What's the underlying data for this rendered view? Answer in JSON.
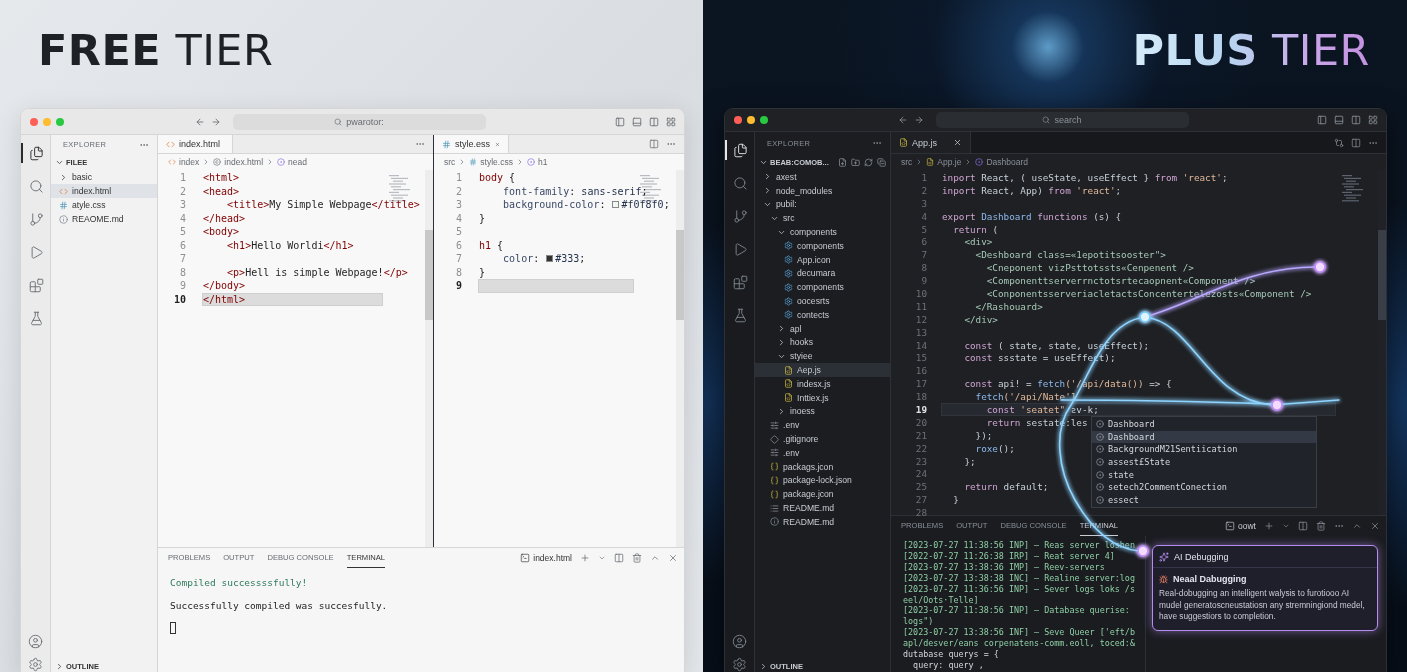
{
  "sides": [
    {
      "kind": "light",
      "heading": {
        "strong": "FREE",
        "light": "TIER"
      },
      "window": {
        "command_center": "pwarotor:",
        "activity": [
          {
            "kind": "files",
            "selected": true
          },
          {
            "kind": "search",
            "selected": false
          },
          {
            "kind": "git",
            "selected": false
          },
          {
            "kind": "run",
            "selected": false
          },
          {
            "kind": "extensions",
            "selected": false
          },
          {
            "kind": "testing",
            "selected": false
          }
        ],
        "sidebar": {
          "title": "EXPLORER",
          "section": "FILEE",
          "section_actions": false,
          "outline": "OUTLINE",
          "items": [
            {
              "label": "basic",
              "kind": "folder",
              "expanded": false,
              "selected": false
            },
            {
              "label": "index.html",
              "kind": "html",
              "selected": true
            },
            {
              "label": "atyle.css",
              "kind": "css",
              "selected": false
            },
            {
              "label": "REAOME.md",
              "kind": "info",
              "selected": false
            }
          ]
        },
        "groups": [
          {
            "tab": {
              "label": "index.html",
              "kind": "html"
            },
            "tab_actions": [
              {
                "kind": "more"
              }
            ],
            "breadcrumbs": [
              {
                "text": "index",
                "kind": "html"
              },
              {
                "text": "index.html",
                "kind": "file"
              },
              {
                "text": "nead",
                "kind": "symbol"
              }
            ],
            "lines": [
              {
                "n": "1",
                "current": false,
                "tokens": [
                  {
                    "kind": "tag",
                    "text": "<html>"
                  }
                ]
              },
              {
                "n": "2",
                "current": false,
                "tokens": [
                  {
                    "kind": "tag",
                    "text": "<head>"
                  }
                ]
              },
              {
                "n": "3",
                "current": false,
                "tokens": [
                  {
                    "kind": "tag",
                    "text": "    <title>"
                  },
                  {
                    "kind": "text",
                    "text": "My Simple Webpage"
                  },
                  {
                    "kind": "tag",
                    "text": "</title>"
                  }
                ]
              },
              {
                "n": "4",
                "current": false,
                "tokens": [
                  {
                    "kind": "tag",
                    "text": "</head>"
                  }
                ]
              },
              {
                "n": "5",
                "current": false,
                "tokens": [
                  {
                    "kind": "tag",
                    "text": "<body>"
                  }
                ]
              },
              {
                "n": "6",
                "current": false,
                "tokens": [
                  {
                    "kind": "tag",
                    "text": "    <h1>"
                  },
                  {
                    "kind": "text",
                    "text": "Hello Worldi"
                  },
                  {
                    "kind": "tag",
                    "text": "</h1>"
                  }
                ]
              },
              {
                "n": "7",
                "current": false
              },
              {
                "n": "8",
                "current": false,
                "tokens": [
                  {
                    "kind": "tag",
                    "text": "    <p>"
                  },
                  {
                    "kind": "text",
                    "text": "Hell is simple Webpage!"
                  },
                  {
                    "kind": "tag",
                    "text": "</p>"
                  }
                ]
              },
              {
                "n": "9",
                "current": false,
                "tokens": [
                  {
                    "kind": "tag",
                    "text": "</body>"
                  }
                ]
              },
              {
                "n": "10",
                "current": true,
                "tokens": [
                  {
                    "kind": "tag",
                    "text": "</html>"
                  }
                ]
              }
            ]
          },
          {
            "tab": {
              "label": "style.ess",
              "kind": "css"
            },
            "tab_actions": [
              {
                "kind": "split"
              },
              {
                "kind": "more"
              }
            ],
            "breadcrumbs": [
              {
                "text": "src",
                "kind": "plain"
              },
              {
                "text": "style.css",
                "kind": "css"
              },
              {
                "text": "h1",
                "kind": "symbol"
              }
            ],
            "lines": [
              {
                "n": "1",
                "current": false,
                "tokens": [
                  {
                    "kind": "sel",
                    "text": "body"
                  },
                  {
                    "kind": "p",
                    "text": " {"
                  }
                ]
              },
              {
                "n": "2",
                "current": false,
                "tokens": [
                  {
                    "kind": "prop",
                    "text": "    font-family"
                  },
                  {
                    "kind": "p",
                    "text": ": "
                  },
                  {
                    "kind": "val",
                    "text": "sans-serif"
                  },
                  {
                    "kind": "p",
                    "text": ";"
                  }
                ]
              },
              {
                "n": "3",
                "current": false,
                "tokens": [
                  {
                    "kind": "prop",
                    "text": "    background-color"
                  },
                  {
                    "kind": "p",
                    "text": ": "
                  },
                  {
                    "kind": "swatch",
                    "color": "#f0f8f0"
                  },
                  {
                    "kind": "val",
                    "text": "#f0f8f0"
                  },
                  {
                    "kind": "p",
                    "text": ";"
                  }
                ]
              },
              {
                "n": "4",
                "current": false,
                "tokens": [
                  {
                    "kind": "p",
                    "text": "}"
                  }
                ]
              },
              {
                "n": "5",
                "current": false
              },
              {
                "n": "6",
                "current": false,
                "tokens": [
                  {
                    "kind": "sel",
                    "text": "h1"
                  },
                  {
                    "kind": "p",
                    "text": " {"
                  }
                ]
              },
              {
                "n": "7",
                "current": false,
                "tokens": [
                  {
                    "kind": "prop",
                    "text": "    color"
                  },
                  {
                    "kind": "p",
                    "text": ": "
                  },
                  {
                    "kind": "swatch",
                    "color": "#333333"
                  },
                  {
                    "kind": "val",
                    "text": "#333"
                  },
                  {
                    "kind": "p",
                    "text": ";"
                  }
                ]
              },
              {
                "n": "8",
                "current": false,
                "tokens": [
                  {
                    "kind": "p",
                    "text": "}"
                  }
                ]
              },
              {
                "n": "9",
                "current": true
              }
            ]
          }
        ],
        "panel": {
          "tabs": [
            {
              "label": "PROBLEMS",
              "selected": false
            },
            {
              "label": "OUTPUT",
              "selected": false
            },
            {
              "label": "DEBUG CONSOLE",
              "selected": false
            },
            {
              "label": "TERMINAL",
              "selected": true
            }
          ],
          "terminal_name": "index.html",
          "actions": [
            {
              "kind": "terminal"
            },
            {
              "kind": "plus"
            },
            {
              "kind": "caret"
            },
            {
              "kind": "split"
            },
            {
              "kind": "trash"
            },
            {
              "kind": "up"
            },
            {
              "kind": "close"
            }
          ],
          "lines": [
            {
              "kind": "success",
              "text": "Compiled successssfully!"
            },
            {
              "kind": "plain",
              "text": "Successfully compiled was succesfully."
            },
            {
              "kind": "cursor"
            }
          ]
        }
      }
    },
    {
      "kind": "dark",
      "heading": {
        "strong": "PLUS",
        "light": "TIER"
      },
      "window": {
        "command_center": "search",
        "activity": [
          {
            "kind": "files",
            "selected": true
          },
          {
            "kind": "search",
            "selected": false
          },
          {
            "kind": "git",
            "selected": false
          },
          {
            "kind": "run",
            "selected": false
          },
          {
            "kind": "extensions",
            "selected": false
          },
          {
            "kind": "testing",
            "selected": false
          }
        ],
        "sidebar": {
          "title": "EXPLORER",
          "section": "BEAB:COMOB...",
          "section_actions": true,
          "outline": "OUTLINE",
          "items": [
            {
              "label": "axest",
              "kind": "folder",
              "expanded": false,
              "selected": false
            },
            {
              "label": "node_modules",
              "kind": "folder",
              "expanded": false,
              "selected": false
            },
            {
              "label": "pubil:",
              "kind": "folder",
              "expanded": true,
              "selected": false,
              "children": [
                {
                  "label": "src",
                  "kind": "folder",
                  "expanded": true,
                  "selected": false,
                  "children": [
                    {
                      "label": "components",
                      "kind": "folder",
                      "expanded": true,
                      "selected": false,
                      "children": [
                        {
                          "label": "components",
                          "kind": "gear",
                          "selected": false
                        },
                        {
                          "label": "App.icon",
                          "kind": "gear",
                          "selected": false
                        },
                        {
                          "label": "decumara",
                          "kind": "gear",
                          "selected": false
                        },
                        {
                          "label": "components",
                          "kind": "gear",
                          "selected": false
                        },
                        {
                          "label": "oocesrts",
                          "kind": "gear",
                          "selected": false
                        },
                        {
                          "label": "contects",
                          "kind": "gear",
                          "selected": false
                        }
                      ]
                    },
                    {
                      "label": "apl",
                      "kind": "folder",
                      "expanded": false,
                      "selected": false
                    },
                    {
                      "label": "hooks",
                      "kind": "folder",
                      "expanded": false,
                      "selected": false
                    },
                    {
                      "label": "styiee",
                      "kind": "folder",
                      "expanded": true,
                      "selected": false,
                      "children": [
                        {
                          "label": "Aep.js",
                          "kind": "js",
                          "selected": true
                        },
                        {
                          "label": "indesx.js",
                          "kind": "js",
                          "selected": false
                        },
                        {
                          "label": "Inttiex.js",
                          "kind": "js",
                          "selected": false
                        }
                      ]
                    },
                    {
                      "label": "inoess",
                      "kind": "folder",
                      "expanded": false,
                      "selected": false
                    }
                  ]
                },
                {
                  "label": ".env",
                  "kind": "env",
                  "selected": false
                },
                {
                  "label": ".gitignore",
                  "kind": "git",
                  "selected": false
                },
                {
                  "label": ".env",
                  "kind": "env",
                  "selected": false
                },
                {
                  "label": "packags.jcon",
                  "kind": "json",
                  "selected": false
                },
                {
                  "label": "package-lock.json",
                  "kind": "json",
                  "selected": false
                },
                {
                  "label": "package.jcon",
                  "kind": "json",
                  "selected": false
                },
                {
                  "label": "README.md",
                  "kind": "md",
                  "selected": false
                },
                {
                  "label": "README.md",
                  "kind": "info",
                  "selected": false
                }
              ]
            }
          ]
        },
        "groups": [
          {
            "tab": {
              "label": "App.js",
              "kind": "js"
            },
            "tab_actions": [
              {
                "kind": "compare"
              },
              {
                "kind": "split"
              },
              {
                "kind": "more"
              }
            ],
            "breadcrumbs": [
              {
                "text": "src",
                "kind": "plain"
              },
              {
                "text": "App.je",
                "kind": "js"
              },
              {
                "text": "Dashboard",
                "kind": "symbol"
              }
            ],
            "lines": [
              {
                "n": "1",
                "current": false,
                "tokens": [
                  {
                    "kind": "kw",
                    "text": "inport"
                  },
                  {
                    "kind": "id",
                    "text": " React, ( useState, useEffect } "
                  },
                  {
                    "kind": "kw",
                    "text": "from"
                  },
                  {
                    "kind": "str",
                    "text": " 'react'"
                  },
                  {
                    "kind": "id",
                    "text": ";"
                  }
                ]
              },
              {
                "n": "2",
                "current": false,
                "tokens": [
                  {
                    "kind": "kw",
                    "text": "inport"
                  },
                  {
                    "kind": "id",
                    "text": " React, App) "
                  },
                  {
                    "kind": "kw",
                    "text": "from"
                  },
                  {
                    "kind": "str",
                    "text": " 'react'"
                  },
                  {
                    "kind": "id",
                    "text": ";"
                  }
                ]
              },
              {
                "n": "3",
                "current": false
              },
              {
                "n": "4",
                "current": false,
                "tokens": [
                  {
                    "kind": "kw",
                    "text": "export"
                  },
                  {
                    "kind": "fn",
                    "text": " Dashboard"
                  },
                  {
                    "kind": "kw",
                    "text": " functions"
                  },
                  {
                    "kind": "id",
                    "text": " (s) {"
                  }
                ]
              },
              {
                "n": "5",
                "current": false,
                "tokens": [
                  {
                    "kind": "kw",
                    "text": "  return"
                  },
                  {
                    "kind": "id",
                    "text": " ("
                  }
                ]
              },
              {
                "n": "6",
                "current": false,
                "tokens": [
                  {
                    "kind": "tag",
                    "text": "    <div>"
                  }
                ]
              },
              {
                "n": "7",
                "current": false,
                "tokens": [
                  {
                    "kind": "tag",
                    "text": "      <Deshboard class=«1epotitsooster\">"
                  }
                ]
              },
              {
                "n": "8",
                "current": false,
                "tokens": [
                  {
                    "kind": "tag",
                    "text": "        <Cneponent vizPsttotssts«Cenpenent />"
                  }
                ]
              },
              {
                "n": "9",
                "current": false,
                "tokens": [
                  {
                    "kind": "tag",
                    "text": "        <Componenttserverrnctotsrtecaopnent«Component />"
                  }
                ]
              },
              {
                "n": "10",
                "current": false,
                "tokens": [
                  {
                    "kind": "tag",
                    "text": "        <ConponentsserveriacletactsConcentertelezosts«Component />"
                  }
                ]
              },
              {
                "n": "11",
                "current": false,
                "tokens": [
                  {
                    "kind": "tag",
                    "text": "      </Rashouard>"
                  }
                ]
              },
              {
                "n": "12",
                "current": false,
                "tokens": [
                  {
                    "kind": "tag",
                    "text": "    </div>"
                  }
                ]
              },
              {
                "n": "13",
                "current": false
              },
              {
                "n": "14",
                "current": false,
                "tokens": [
                  {
                    "kind": "kw",
                    "text": "    const"
                  },
                  {
                    "kind": "id",
                    "text": " ( state, state, useEffect);"
                  }
                ]
              },
              {
                "n": "15",
                "current": false,
                "tokens": [
                  {
                    "kind": "kw",
                    "text": "    const"
                  },
                  {
                    "kind": "id",
                    "text": " ssstate = useEffect);"
                  }
                ]
              },
              {
                "n": "16",
                "current": false
              },
              {
                "n": "17",
                "current": false,
                "tokens": [
                  {
                    "kind": "kw",
                    "text": "    const"
                  },
                  {
                    "kind": "id",
                    "text": " api! = "
                  },
                  {
                    "kind": "fn",
                    "text": "fetch"
                  },
                  {
                    "kind": "str",
                    "text": "('/api/data())"
                  },
                  {
                    "kind": "id",
                    "text": " => {"
                  }
                ]
              },
              {
                "n": "18",
                "current": false,
                "tokens": [
                  {
                    "kind": "fn",
                    "text": "      fetch"
                  },
                  {
                    "kind": "str",
                    "text": "('/api/Nate'1"
                  }
                ]
              },
              {
                "n": "19",
                "current": true,
                "tokens": [
                  {
                    "kind": "kw",
                    "text": "        const"
                  },
                  {
                    "kind": "str",
                    "text": " 'seatet\""
                  },
                  {
                    "kind": "id",
                    "text": " ƨv-k;"
                  }
                ]
              },
              {
                "n": "20",
                "current": false,
                "tokens": [
                  {
                    "kind": "kw",
                    "text": "        return"
                  },
                  {
                    "kind": "id",
                    "text": " sestate:les"
                  }
                ]
              },
              {
                "n": "21",
                "current": false,
                "tokens": [
                  {
                    "kind": "id",
                    "text": "      });"
                  }
                ]
              },
              {
                "n": "22",
                "current": false,
                "tokens": [
                  {
                    "kind": "fn",
                    "text": "      roxe"
                  },
                  {
                    "kind": "id",
                    "text": "();"
                  }
                ]
              },
              {
                "n": "23",
                "current": false,
                "tokens": [
                  {
                    "kind": "id",
                    "text": "    };"
                  }
                ]
              },
              {
                "n": "24",
                "current": false
              },
              {
                "n": "25",
                "current": false,
                "tokens": [
                  {
                    "kind": "kw",
                    "text": "    return"
                  },
                  {
                    "kind": "id",
                    "text": " default;"
                  }
                ]
              },
              {
                "n": "27",
                "current": false,
                "tokens": [
                  {
                    "kind": "id",
                    "text": "  }"
                  }
                ]
              },
              {
                "n": "28",
                "current": false
              }
            ],
            "suggestions": [
              {
                "label": "Dashboard",
                "selected": false
              },
              {
                "label": "Dashboard",
                "selected": true
              },
              {
                "label": "BackgroundM21Sentiication",
                "selected": false
              },
              {
                "label": "assest£State",
                "selected": false
              },
              {
                "label": "state",
                "selected": false
              },
              {
                "label": "setech2CommentConection",
                "selected": false
              },
              {
                "label": "essect",
                "selected": false
              }
            ]
          }
        ],
        "panel": {
          "tabs": [
            {
              "label": "PROBLEMS",
              "selected": false
            },
            {
              "label": "OUTPUT",
              "selected": false
            },
            {
              "label": "DEBUG CONSOLE",
              "selected": false
            },
            {
              "label": "TERMINAL",
              "selected": true
            }
          ],
          "terminal_name": "oowt",
          "actions": [
            {
              "kind": "terminal"
            },
            {
              "kind": "plus"
            },
            {
              "kind": "caret"
            },
            {
              "kind": "split"
            },
            {
              "kind": "trash"
            },
            {
              "kind": "more"
            },
            {
              "kind": "up"
            },
            {
              "kind": "close"
            }
          ],
          "lines": [
            {
              "kind": "log",
              "text": "[2023-07-27 11:38:56 INP] – Reas server loshen"
            },
            {
              "kind": "log",
              "text": "[2022-07-27 11:26:38 IRP] – Reat server 4]"
            },
            {
              "kind": "log",
              "text": "[2023-07-27 13:38:36 IMP] – Reev-servers"
            },
            {
              "kind": "log",
              "text": "[2023-07-27 13:38:38 INC] – Realine server:log"
            },
            {
              "kind": "log",
              "text": "[2023-07-27 11:36:56 INP] – Sever logs loks /s"
            },
            {
              "kind": "log",
              "text": "eel/Oots·Telle]"
            },
            {
              "kind": "log",
              "text": "[2023-07-27 11:38:56 INP] – Database querise:"
            },
            {
              "kind": "log",
              "text": "logs\")"
            },
            {
              "kind": "log",
              "text": "[2023-07-27 13:38:56 INF] – Seve Queer ['eft/b"
            },
            {
              "kind": "log",
              "text": "apl/desver/eans corpenatens-comm.eoll, toced:&"
            },
            {
              "kind": "plain",
              "text": "dutabase querys = {"
            },
            {
              "kind": "plain",
              "text": "  query: query ,"
            }
          ],
          "card": {
            "title": "AI Debugging",
            "heading": "Neaal Dabugging",
            "body": "Real-dobugging an intelligent walysis to furotiooo AI mudel generatoscneustatiosn any stremningiond medel, have suggestiors to completion."
          }
        }
      }
    }
  ]
}
